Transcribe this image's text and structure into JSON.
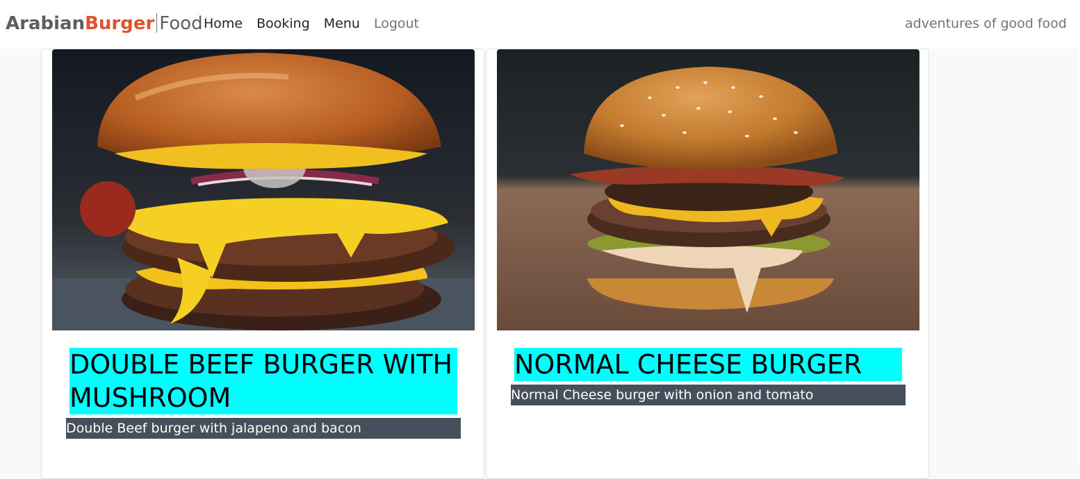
{
  "brand": {
    "part1": "Arabian",
    "part2": "Burger",
    "part3": "Food"
  },
  "nav": {
    "home": "Home",
    "booking": "Booking",
    "menu": "Menu",
    "logout": "Logout"
  },
  "tagline": "adventures of good food",
  "colors": {
    "brand_accent": "#e0522e",
    "title_highlight": "#00ffff",
    "desc_background": "#464f5c"
  },
  "cards": [
    {
      "image_icon": "burger-photo",
      "title": "DOUBLE BEEF BURGER WITH MUSHROOM",
      "description": "Double Beef burger with jalapeno and bacon"
    },
    {
      "image_icon": "burger-photo",
      "title": "NORMAL CHEESE BURGER",
      "description": "Normal Cheese burger with onion and tomato"
    }
  ]
}
